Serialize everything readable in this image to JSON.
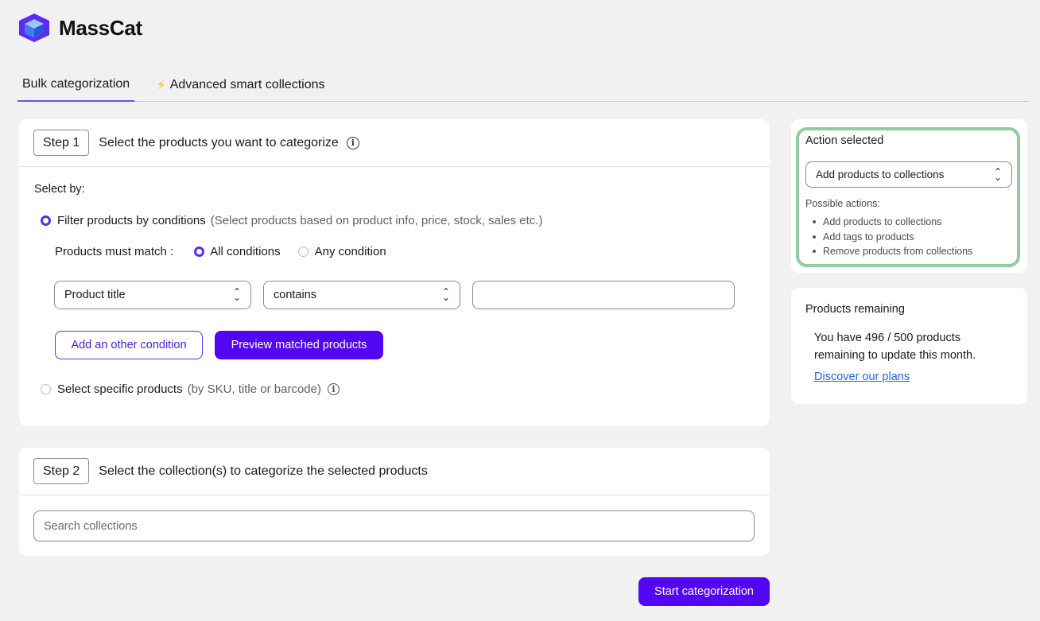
{
  "app": {
    "name": "MassCat"
  },
  "tabs": [
    {
      "label": "Bulk categorization",
      "active": true
    },
    {
      "label": "Advanced smart collections",
      "icon": "lightning-icon"
    }
  ],
  "step1": {
    "badge": "Step 1",
    "title": "Select the products you want to categorize",
    "select_by_label": "Select by:",
    "filter_option": {
      "label": "Filter products by conditions",
      "hint": "(Select products based on product info, price, stock, sales etc.)",
      "checked": true
    },
    "match_label": "Products must match :",
    "match_options": [
      {
        "label": "All conditions",
        "checked": true
      },
      {
        "label": "Any condition",
        "checked": false
      }
    ],
    "condition": {
      "field": "Product title",
      "operator": "contains",
      "value": ""
    },
    "add_condition_label": "Add an other condition",
    "preview_label": "Preview matched products",
    "specific_option": {
      "label": "Select specific products",
      "hint": "(by SKU, title or barcode)",
      "checked": false
    }
  },
  "step2": {
    "badge": "Step 2",
    "title": "Select the collection(s) to categorize the selected products",
    "search_placeholder": "Search collections"
  },
  "start_label": "Start categorization",
  "action_panel": {
    "title": "Action selected",
    "selected": "Add products to collections",
    "possible_label": "Possible actions:",
    "possible": [
      "Add products to collections",
      "Add tags to products",
      "Remove products from collections"
    ]
  },
  "remaining_panel": {
    "title": "Products remaining",
    "line1": "You have 496 / 500 products",
    "line2": "remaining to update this month.",
    "link": "Discover our plans"
  },
  "colors": {
    "accent": "#5206f2",
    "highlight": "#8fcca0"
  }
}
